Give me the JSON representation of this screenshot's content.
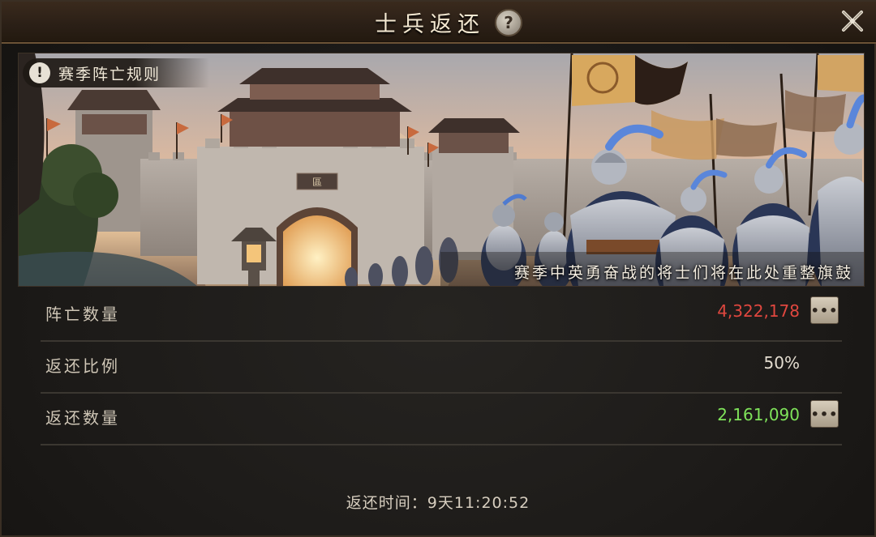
{
  "header": {
    "title": "士兵返还",
    "help_icon": "question-mark-icon",
    "close_icon": "close-x-icon"
  },
  "banner": {
    "rules_label": "赛季阵亡规则",
    "caption": "赛季中英勇奋战的将士们将在此处重整旗鼓",
    "gate_plaque": "區"
  },
  "rows": [
    {
      "label": "阵亡数量",
      "value": "4,322,178",
      "color": "#e0473f",
      "has_more": true
    },
    {
      "label": "返还比例",
      "value": "50%",
      "color": "#e4ddd0",
      "has_more": false
    },
    {
      "label": "返还数量",
      "value": "2,161,090",
      "color": "#7fe35a",
      "has_more": true
    }
  ],
  "footer": {
    "return_time_label": "返还时间：",
    "return_time_value": "9天11:20:52"
  },
  "colors": {
    "title_bar": "#2a1f16",
    "panel_bg": "#1d1b19",
    "divider": "#3b3731"
  }
}
